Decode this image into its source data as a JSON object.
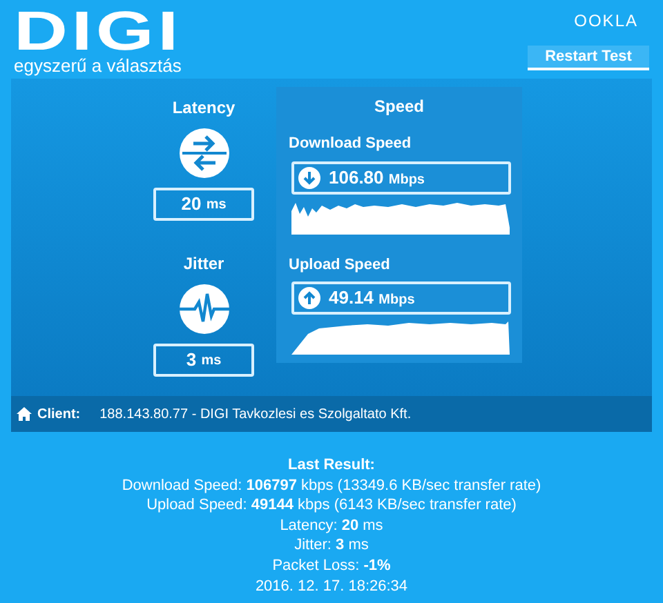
{
  "header": {
    "logo": "DIGI",
    "tagline": "egyszerű a választás",
    "brand": "OOKLA",
    "restart_button": "Restart Test"
  },
  "metrics": [
    {
      "kind": "latency",
      "label": "Latency",
      "value": "20",
      "unit": "ms"
    },
    {
      "kind": "jitter",
      "label": "Jitter",
      "value": "3",
      "unit": "ms"
    }
  ],
  "speed": {
    "title": "Speed",
    "tests": [
      {
        "kind": "download",
        "label": "Download Speed",
        "value": "106.80",
        "unit": "Mbps"
      },
      {
        "kind": "upload",
        "label": "Upload Speed",
        "value": "49.14",
        "unit": "Mbps"
      }
    ]
  },
  "client": {
    "label": "Client:",
    "value": "188.143.80.77 - DIGI Tavkozlesi es Szolgaltato Kft."
  },
  "last_result": {
    "title": "Last Result:",
    "lines": [
      "Download Speed: **106797** kbps (13349.6 KB/sec transfer rate)",
      "Upload Speed: **49144** kbps (6143 KB/sec transfer rate)",
      "Latency: **20** ms",
      "Jitter: **3** ms",
      "Packet Loss: **-1%**",
      "2016. 12. 17. 18:26:34"
    ]
  }
}
